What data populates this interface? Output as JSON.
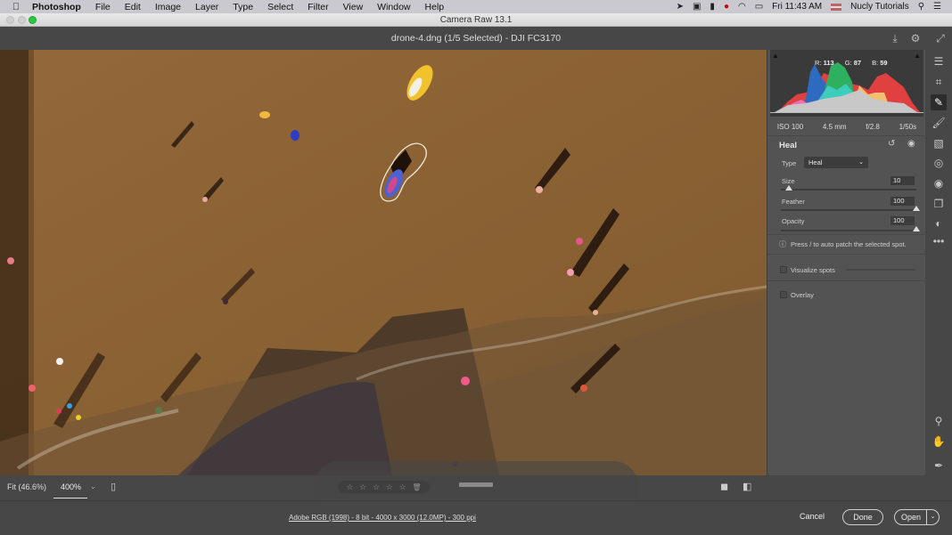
{
  "menubar": {
    "apple_icon": "apple-icon",
    "app_name": "Photoshop",
    "items": [
      "File",
      "Edit",
      "Image",
      "Layer",
      "Type",
      "Select",
      "Filter",
      "View",
      "Window",
      "Help"
    ],
    "clock": "Fri 11:43 AM",
    "user": "Nucly Tutorials"
  },
  "window": {
    "title": "Camera Raw 13.1"
  },
  "header": {
    "document": "drone-4.dng (1/5 Selected)  -  DJI FC3170"
  },
  "histogram": {
    "r_label": "R:",
    "r_value": "113",
    "g_label": "G:",
    "g_value": "87",
    "b_label": "B:",
    "b_value": "59"
  },
  "exif": {
    "iso": "ISO 100",
    "focal": "4.5 mm",
    "aperture": "f/2.8",
    "shutter": "1/50s"
  },
  "heal_panel": {
    "title": "Heal",
    "type_label": "Type",
    "type_value": "Heal",
    "size_label": "Size",
    "size_value": "10",
    "size_fraction": 0.06,
    "feather_label": "Feather",
    "feather_value": "100",
    "feather_fraction": 1.0,
    "opacity_label": "Opacity",
    "opacity_value": "100",
    "opacity_fraction": 1.0,
    "hint": "Press / to auto patch the selected spot.",
    "visualize_label": "Visualize spots",
    "overlay_label": "Overlay"
  },
  "bottombar": {
    "fit_label": "Fit (46.6%)",
    "zoom_value": "400%",
    "stars": [
      "☆",
      "☆",
      "☆",
      "☆",
      "☆"
    ]
  },
  "footer": {
    "workflow_link": "Adobe RGB (1998) - 8 bit - 4000 x 3000 (12.0MP) - 300 ppi",
    "cancel": "Cancel",
    "done": "Done",
    "open": "Open"
  },
  "colors": {
    "accent_sand": "#8c6434",
    "panel_bg": "#535353",
    "dark_bar": "#474747"
  }
}
